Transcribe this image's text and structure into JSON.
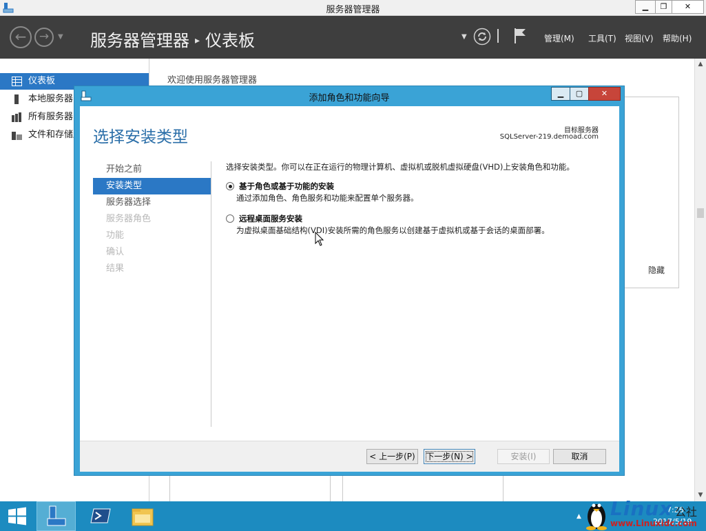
{
  "window": {
    "title": "服务器管理器",
    "minimize_glyph": "▁",
    "restore_glyph": "❐",
    "close_glyph": "✕"
  },
  "toolbar": {
    "back_glyph": "←",
    "forward_glyph": "→",
    "breadcrumb_root": "服务器管理器",
    "breadcrumb_sep": "▸",
    "breadcrumb_current": "仪表板",
    "menus": [
      {
        "label": "管理(M)"
      },
      {
        "label": "工具(T)"
      },
      {
        "label": "视图(V)"
      },
      {
        "label": "帮助(H)"
      }
    ]
  },
  "sidebar": {
    "items": [
      {
        "label": "仪表板",
        "icon": "dashboard-icon"
      },
      {
        "label": "本地服务器",
        "icon": "server-icon"
      },
      {
        "label": "所有服务器",
        "icon": "servers-icon"
      },
      {
        "label": "文件和存储服务",
        "icon": "storage-icon"
      }
    ]
  },
  "main": {
    "welcome": "欢迎使用服务器管理器",
    "hide_link": "隐藏"
  },
  "wizard": {
    "title": "添加角色和功能向导",
    "heading": "选择安装类型",
    "target_label": "目标服务器",
    "target_server": "SQLServer-219.demoad.com",
    "steps": [
      {
        "label": "开始之前",
        "state": "done"
      },
      {
        "label": "安装类型",
        "state": "active"
      },
      {
        "label": "服务器选择",
        "state": "done"
      },
      {
        "label": "服务器角色",
        "state": "disabled"
      },
      {
        "label": "功能",
        "state": "disabled"
      },
      {
        "label": "确认",
        "state": "disabled"
      },
      {
        "label": "结果",
        "state": "disabled"
      }
    ],
    "description": "选择安装类型。你可以在正在运行的物理计算机、虚拟机或脱机虚拟硬盘(VHD)上安装角色和功能。",
    "options": [
      {
        "title": "基于角色或基于功能的安装",
        "desc": "通过添加角色、角色服务和功能来配置单个服务器。",
        "checked": true
      },
      {
        "title": "远程桌面服务安装",
        "desc": "为虚拟桌面基础结构(VDI)安装所需的角色服务以创建基于虚拟机或基于会话的桌面部署。",
        "checked": false
      }
    ],
    "buttons": {
      "prev": "< 上一步(P)",
      "next": "下一步(N) >",
      "install": "安装(I)",
      "cancel": "取消"
    }
  },
  "taskbar": {
    "time": "7:26",
    "date": "2017/5/19",
    "watermark_brand": "Linux",
    "watermark_cn": "公社",
    "watermark_url": "www.Linuxidc.com"
  },
  "colors": {
    "accent": "#2b78c5",
    "wizard_frame": "#3aa3d6",
    "taskbar": "#1c8bc0",
    "toolbar": "#3e3e3e"
  }
}
